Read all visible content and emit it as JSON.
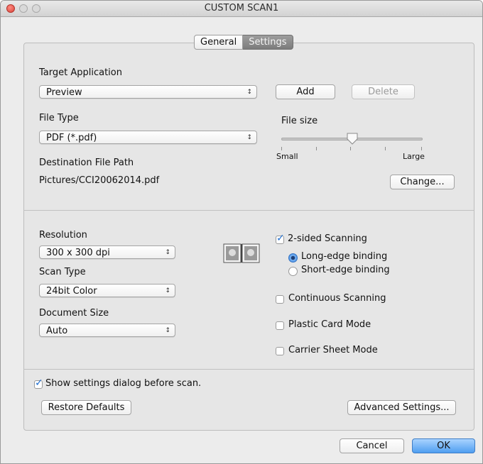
{
  "window": {
    "title": "CUSTOM SCAN1"
  },
  "tabs": [
    {
      "label": "General",
      "selected": false
    },
    {
      "label": "Settings",
      "selected": true
    }
  ],
  "target_application": {
    "label": "Target Application",
    "value": "Preview",
    "add_label": "Add",
    "delete_label": "Delete"
  },
  "file_type": {
    "label": "File Type",
    "value": "PDF (*.pdf)"
  },
  "file_size": {
    "label": "File size",
    "min_label": "Small",
    "max_label": "Large",
    "level": 0.5
  },
  "destination": {
    "label": "Destination File Path",
    "path": "Pictures/CCI20062014.pdf",
    "change_label": "Change..."
  },
  "resolution": {
    "label": "Resolution",
    "value": "300 x 300 dpi"
  },
  "scan_type": {
    "label": "Scan Type",
    "value": "24bit Color"
  },
  "document_size": {
    "label": "Document Size",
    "value": "Auto"
  },
  "duplex_icon": "two-sided-pages-icon",
  "options": {
    "two_sided": {
      "label": "2-sided Scanning",
      "checked": true
    },
    "long_edge": {
      "label": "Long-edge binding",
      "selected": true
    },
    "short_edge": {
      "label": "Short-edge binding",
      "selected": false
    },
    "continuous": {
      "label": "Continuous Scanning",
      "checked": false
    },
    "plastic_card": {
      "label": "Plastic Card Mode",
      "checked": false
    },
    "carrier_sheet": {
      "label": "Carrier Sheet Mode",
      "checked": false
    }
  },
  "show_settings": {
    "label": "Show settings dialog before scan.",
    "checked": true
  },
  "restore_label": "Restore Defaults",
  "advanced_label": "Advanced Settings...",
  "cancel_label": "Cancel",
  "ok_label": "OK",
  "colors": {
    "accent": "#4f9ef0",
    "check": "#1f6fd1"
  }
}
